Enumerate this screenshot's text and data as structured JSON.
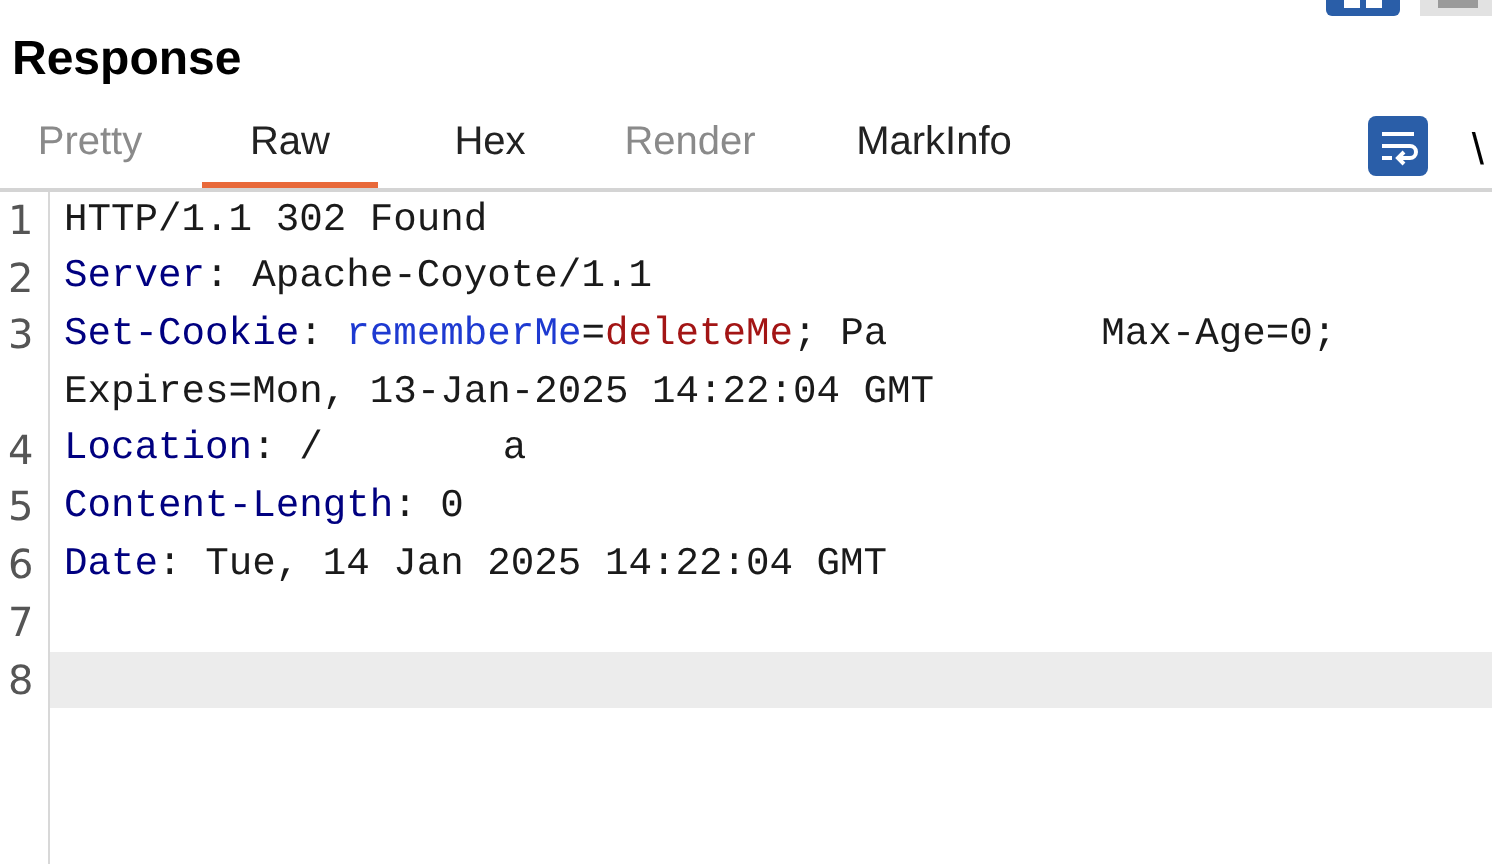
{
  "panel": {
    "title": "Response"
  },
  "tabs": [
    {
      "label": "Pretty",
      "selected": false,
      "disabled": true
    },
    {
      "label": "Raw",
      "selected": true,
      "disabled": false
    },
    {
      "label": "Hex",
      "selected": false,
      "disabled": false
    },
    {
      "label": "Render",
      "selected": false,
      "disabled": true
    },
    {
      "label": "MarkInfo",
      "selected": false,
      "disabled": false
    }
  ],
  "toolbar": {
    "newline_toggle": "\\"
  },
  "editor": {
    "lines": [
      {
        "number": "1",
        "highlighted": false,
        "rows": [
          [
            {
              "kind": "plain",
              "text": "HTTP/1.1 302 Found"
            }
          ]
        ]
      },
      {
        "number": "2",
        "highlighted": false,
        "rows": [
          [
            {
              "kind": "header",
              "text": "Server"
            },
            {
              "kind": "plain",
              "text": ": Apache-Coyote/1.1"
            }
          ]
        ]
      },
      {
        "number": "3",
        "highlighted": false,
        "rows": [
          [
            {
              "kind": "header",
              "text": "Set-Cookie"
            },
            {
              "kind": "plain",
              "text": ": "
            },
            {
              "kind": "cookie_name",
              "text": "rememberMe"
            },
            {
              "kind": "plain",
              "text": "="
            },
            {
              "kind": "cookie_value",
              "text": "deleteMe"
            },
            {
              "kind": "plain",
              "text": "; Pa"
            },
            {
              "kind": "gap"
            },
            {
              "kind": "plain",
              "text": "Max-Age=0;"
            }
          ],
          [
            {
              "kind": "plain",
              "text": "Expires=Mon, 13-Jan-2025 14:22:04 GMT"
            }
          ]
        ]
      },
      {
        "number": "4",
        "highlighted": false,
        "rows": [
          [
            {
              "kind": "header",
              "text": "Location"
            },
            {
              "kind": "plain",
              "text": ": /"
            },
            {
              "kind": "gap"
            },
            {
              "kind": "plain",
              "text": "a"
            }
          ]
        ]
      },
      {
        "number": "5",
        "highlighted": false,
        "rows": [
          [
            {
              "kind": "header",
              "text": "Content-Length"
            },
            {
              "kind": "plain",
              "text": ": 0"
            }
          ]
        ]
      },
      {
        "number": "6",
        "highlighted": false,
        "rows": [
          [
            {
              "kind": "header",
              "text": "Date"
            },
            {
              "kind": "plain",
              "text": ": Tue, 14 Jan 2025 14:22:04 GMT"
            }
          ]
        ]
      },
      {
        "number": "7",
        "highlighted": false,
        "rows": [
          []
        ]
      },
      {
        "number": "8",
        "highlighted": true,
        "rows": [
          []
        ]
      }
    ]
  }
}
